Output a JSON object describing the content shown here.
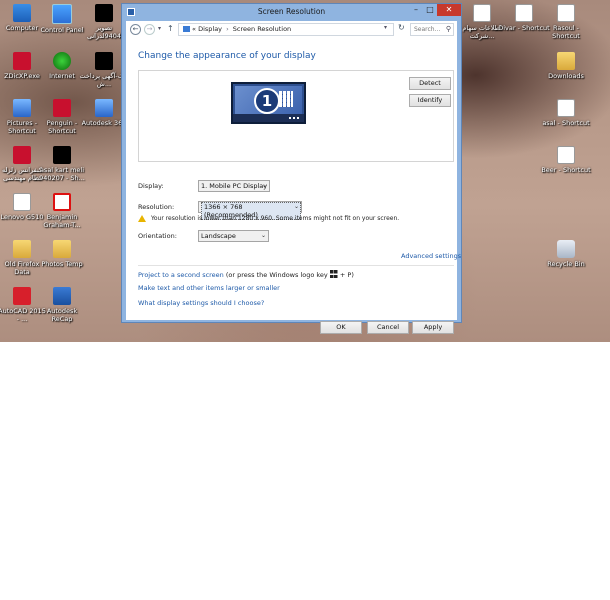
{
  "desktop": {
    "icons": [
      {
        "label": "Computer",
        "icon": "computer-icon",
        "kind": "pc"
      },
      {
        "label": "Control Panel",
        "icon": "control-panel-icon",
        "kind": "cp"
      },
      {
        "label": "تصویر 9404لدرانی",
        "icon": "image-file-icon",
        "kind": "black"
      },
      {
        "label": "ZDicXP.exe",
        "icon": "app-icon",
        "kind": "red"
      },
      {
        "label": "Internet",
        "icon": "internet-icon",
        "kind": "green"
      },
      {
        "label": "ونک-آگهی پرداخت ش...",
        "icon": "image-file-icon",
        "kind": "black"
      },
      {
        "label": "Pictures - Shortcut",
        "icon": "pictures-icon",
        "kind": "blue"
      },
      {
        "label": "Penguin - Shortcut",
        "icon": "pdf-icon",
        "kind": "red"
      },
      {
        "label": "Autodesk 360",
        "icon": "autodesk-icon",
        "kind": "blue"
      },
      {
        "label": "کنفرانس زلزله نظام مهندسی",
        "icon": "pdf-icon",
        "kind": "red"
      },
      {
        "label": "asal kart meli 940207 - Sh...",
        "icon": "image-file-icon",
        "kind": "black"
      },
      {
        "label": "Lenovo G510",
        "icon": "document-icon",
        "kind": "doc"
      },
      {
        "label": "Benjamin Graham-T...",
        "icon": "pdf-icon",
        "kind": "pdf"
      },
      {
        "label": "Old Firefox Data",
        "icon": "folder-icon",
        "kind": "folder"
      },
      {
        "label": "Photos Temp",
        "icon": "folder-icon",
        "kind": "folder"
      },
      {
        "label": "AutoCAD 2015 - ...",
        "icon": "autocad-icon",
        "kind": "acad"
      },
      {
        "label": "Autodesk ReCap",
        "icon": "recap-icon",
        "kind": "recap"
      },
      {
        "label": "اطلاعات سهام شرکت...",
        "icon": "file-icon",
        "kind": "doc"
      },
      {
        "label": "Divar - Shortcut",
        "icon": "shortcut-icon",
        "kind": "doc"
      },
      {
        "label": "Rasoul - Shortcut",
        "icon": "shortcut-icon",
        "kind": "doc"
      },
      {
        "label": "Downloads",
        "icon": "folder-icon",
        "kind": "folder"
      },
      {
        "label": "asal - Shortcut",
        "icon": "shortcut-icon",
        "kind": "doc"
      },
      {
        "label": "Beer - Shortcut",
        "icon": "shortcut-icon",
        "kind": "doc"
      },
      {
        "label": "Recycle Bin",
        "icon": "recycle-bin-icon",
        "kind": "bin"
      }
    ]
  },
  "window": {
    "title": "Screen Resolution",
    "controls": {
      "minimize": "–",
      "maximize": "□",
      "close": "✕"
    },
    "address": {
      "prefix": "«",
      "crumbs": [
        "Display",
        "Screen Resolution"
      ],
      "separator": "›",
      "search_placeholder": "Search..."
    },
    "heading": "Change the appearance of your display",
    "monitor_number": "1",
    "buttons": {
      "detect": "Detect",
      "identify": "Identify",
      "ok": "OK",
      "cancel": "Cancel",
      "apply": "Apply"
    },
    "fields": {
      "display_label": "Display:",
      "display_value": "1. Mobile PC Display",
      "resolution_label": "Resolution:",
      "resolution_value": "1366 × 768 (Recommended)",
      "orientation_label": "Orientation:",
      "orientation_value": "Landscape"
    },
    "warning": "Your resolution is lower than 1280 x 960. Some items might not fit on your screen.",
    "links": {
      "advanced": "Advanced settings",
      "project": "Project to a second screen",
      "project_suffix_a": " (or press the Windows logo key ",
      "project_suffix_b": " + P)",
      "text_size": "Make text and other items larger or smaller",
      "choose": "What display settings should I choose?"
    }
  },
  "colors": {
    "link": "#1e5aa8",
    "accent": "#8fb4e0",
    "close": "#c7392c",
    "warning": "#e8b400"
  }
}
